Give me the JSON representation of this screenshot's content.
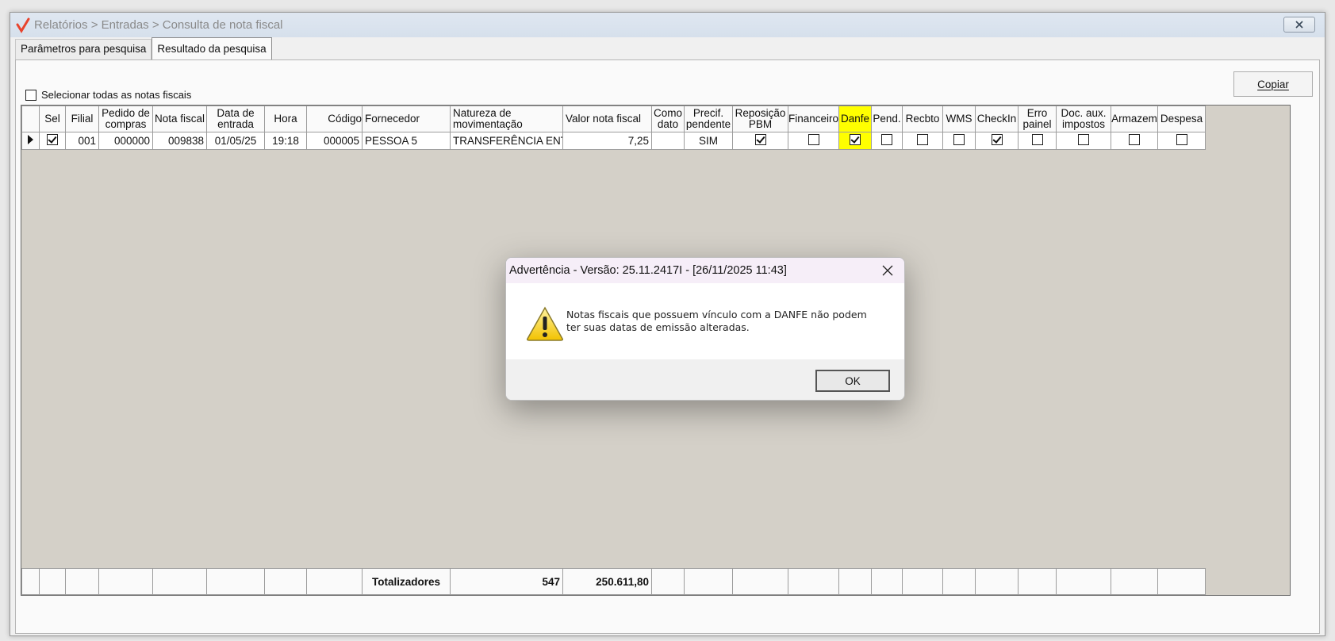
{
  "window": {
    "title": "Relatórios > Entradas > Consulta de nota fiscal",
    "close_icon": "close-icon"
  },
  "tabs": [
    {
      "label": "Parâmetros para pesquisa",
      "active": false
    },
    {
      "label": "Resultado da pesquisa",
      "active": true
    }
  ],
  "select_all_label": "Selecionar todas as notas fiscais",
  "copy_button_label": "Copiar",
  "columns": [
    {
      "line1": "",
      "line2": ""
    },
    {
      "line1": "Sel",
      "line2": ""
    },
    {
      "line1": "Filial",
      "line2": ""
    },
    {
      "line1": "Pedido de",
      "line2": "compras"
    },
    {
      "line1": "Nota fiscal",
      "line2": ""
    },
    {
      "line1": "Data de",
      "line2": "entrada"
    },
    {
      "line1": "Hora",
      "line2": ""
    },
    {
      "line1": "Código",
      "line2": ""
    },
    {
      "line1": "Fornecedor",
      "line2": ""
    },
    {
      "line1": "Natureza de",
      "line2": "movimentação"
    },
    {
      "line1": "Valor nota fiscal",
      "line2": ""
    },
    {
      "line1": "Como",
      "line2": "dato"
    },
    {
      "line1": "Precif.",
      "line2": "pendente"
    },
    {
      "line1": "Reposição",
      "line2": "PBM"
    },
    {
      "line1": "Financeiro",
      "line2": ""
    },
    {
      "line1": "Danfe",
      "line2": ""
    },
    {
      "line1": "Pend.",
      "line2": ""
    },
    {
      "line1": "Recbto",
      "line2": ""
    },
    {
      "line1": "WMS",
      "line2": ""
    },
    {
      "line1": "CheckIn",
      "line2": ""
    },
    {
      "line1": "Erro",
      "line2": "painel"
    },
    {
      "line1": "Doc. aux.",
      "line2": "impostos"
    },
    {
      "line1": "Armazem",
      "line2": ""
    },
    {
      "line1": "Despesa",
      "line2": ""
    }
  ],
  "row": {
    "sel": true,
    "filial": "001",
    "pedido": "000000",
    "nota_fiscal": "009838",
    "data_entrada": "01/05/25",
    "hora": "19:18",
    "codigo": "000005",
    "fornecedor": "PESSOA 5",
    "natureza": "TRANSFERÊNCIA ENTI",
    "valor": "7,25",
    "como_dato": "",
    "precif_pendente": "SIM",
    "reposicao_pbm": true,
    "financeiro": false,
    "danfe": true,
    "pend": false,
    "recbto": false,
    "wms": false,
    "checkin": true,
    "erro_painel": false,
    "doc_aux_impostos": false,
    "armazem": false,
    "despesa": false
  },
  "totals": {
    "label": "Totalizadores",
    "count": "547",
    "valor": "250.611,80"
  },
  "colors": {
    "highlight": "#ffff00",
    "grid_background": "#d4d0c8"
  },
  "dialog": {
    "title": "Advertência - Versão: 25.11.2417I - [26/11/2025 11:43]",
    "message_line1": "Notas fiscais que possuem vínculo com a DANFE não podem",
    "message_line2": "ter suas datas de emissão alteradas.",
    "ok_label": "OK",
    "icon": "warning-icon"
  }
}
